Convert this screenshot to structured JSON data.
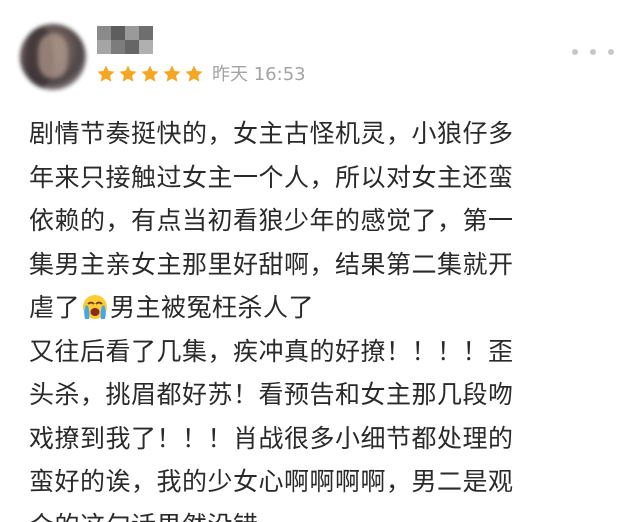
{
  "review": {
    "rating": 5,
    "rating_max": 5,
    "timestamp": "昨天 16:53",
    "colors": {
      "star": "#f5a623",
      "timestamp": "#a3a3a3",
      "text": "#2a2a2a"
    },
    "emoji_name": "loudly-crying-face-icon",
    "content": {
      "line1": "剧情节奏挺快的，女主古怪机灵，小狼仔多",
      "line2": "年来只接触过女主一个人，所以对女主还蛮",
      "line3": "依赖的，有点当初看狼少年的感觉了，第一",
      "line4": "集男主亲女主那里好甜啊，结果第二集就开",
      "line5_before": "虐了",
      "line5_after": "男主被冤枉杀人了",
      "line6": "又往后看了几集，疾冲真的好撩！！！！歪",
      "line7": "头杀，挑眉都好苏！看预告和女主那几段吻",
      "line8": "戏撩到我了！！！肖战很多小细节都处理的",
      "line9": "蛮好的诶，我的少女心啊啊啊啊，男二是观",
      "line10": "众的这句话果然没错"
    }
  }
}
